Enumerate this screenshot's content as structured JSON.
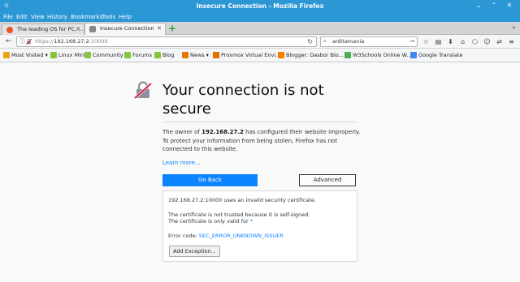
{
  "window": {
    "title": "Insecure Connection - Mozilla Firefox",
    "controls": {
      "minimize": "⌄",
      "maximize": "⌃",
      "close": "✕"
    }
  },
  "menu": [
    "File",
    "Edit",
    "View",
    "History",
    "Bookmarks",
    "Tools",
    "Help"
  ],
  "tabs": [
    {
      "label": "The leading OS for PC, ...",
      "active": false
    },
    {
      "label": "Insecure Connection",
      "active": true
    }
  ],
  "nav": {
    "url_prefix": "https://",
    "url_host": "192.168.27.2",
    "url_port": ":10000",
    "search_value": "arditamania"
  },
  "bookmarks": [
    "Most Visited",
    "Linux Mint",
    "Community",
    "Forums",
    "Blog",
    "News",
    "Proxmox Virtual Envi...",
    "Blogger: Dasbor Blo...",
    "W3Schools Online W...",
    "Google Translate"
  ],
  "error": {
    "heading": "Your connection is not secure",
    "desc_pre": "The owner of ",
    "desc_host": "192.168.27.2",
    "desc_post": " has configured their website improperly. To protect your information from being stolen, Firefox has not connected to this website.",
    "learn_more": "Learn more…",
    "go_back": "Go Back",
    "advanced": "Advanced",
    "adv_line1": "192.168.27.2:10000 uses an invalid security certificate.",
    "adv_line2": "The certificate is not trusted because it is self-signed.",
    "adv_line3": "The certificate is only valid for",
    "adv_line3_link": "*",
    "error_code_label": "Error code: ",
    "error_code": "SEC_ERROR_UNKNOWN_ISSUER",
    "add_exception": "Add Exception..."
  },
  "colors": {
    "titlebar": "#2b97d5",
    "primary_button": "#0a84ff",
    "link": "#0a84ff"
  }
}
